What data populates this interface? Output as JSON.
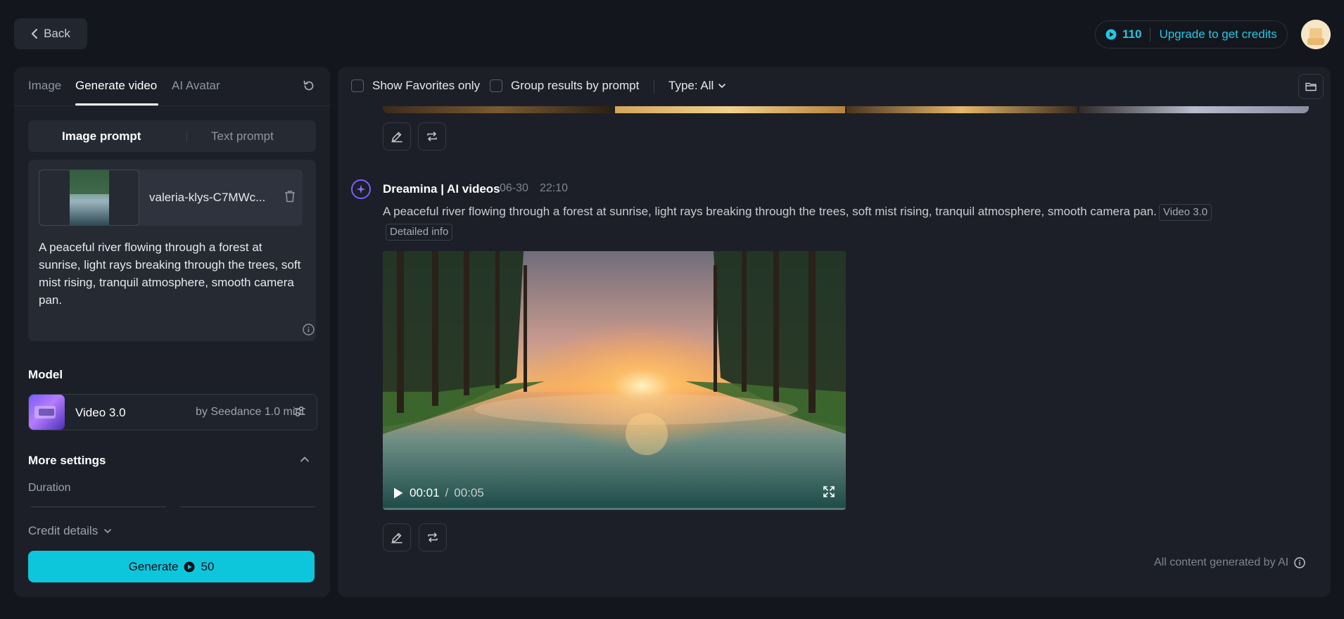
{
  "header": {
    "back_label": "Back",
    "credits": "110",
    "upgrade_label": "Upgrade to get credits"
  },
  "left_panel": {
    "tabs": [
      {
        "label": "Image"
      },
      {
        "label": "Generate video"
      },
      {
        "label": "AI Avatar"
      }
    ],
    "active_tab": "Generate video",
    "prompt_modes": [
      {
        "label": "Image prompt"
      },
      {
        "label": "Text prompt"
      }
    ],
    "active_mode": "Image prompt",
    "file_name": "valeria-klys-C7MWc...",
    "prompt_text": "A peaceful river flowing through a forest at sunrise, light rays breaking through the trees, soft mist rising, tranquil atmosphere, smooth camera pan.",
    "model_label": "Model",
    "model_name": "Video 3.0",
    "model_by": "by Seedance 1.0 mini",
    "more_settings_label": "More settings",
    "duration_label": "Duration",
    "credit_details_label": "Credit details",
    "generate_label": "Generate",
    "generate_cost": "50"
  },
  "right_panel": {
    "filters": {
      "favorites_label": "Show Favorites only",
      "group_label": "Group results by prompt",
      "type_label": "Type: All"
    },
    "post": {
      "author": "Dreamina | AI videos",
      "date": "06-30",
      "time": "22:10",
      "prompt": "A peaceful river flowing through a forest at sunrise, light rays breaking through the trees, soft mist rising, tranquil atmosphere, smooth camera pan.",
      "model_badge": "Video 3.0",
      "details_badge": "Detailed info",
      "video_current": "00:01",
      "video_separator": "/",
      "video_total": "00:05"
    },
    "footer_note": "All content generated by AI"
  },
  "colors": {
    "accent": "#0ec6dc",
    "brand_purple": "#7c5cff",
    "background": "#13161d",
    "panel": "#1c1f27"
  },
  "icons": [
    "chevron-left-icon",
    "credit-coin-icon",
    "refresh-icon",
    "trash-icon",
    "info-icon",
    "sliders-icon",
    "chevron-up-icon",
    "chevron-down-icon",
    "folder-icon",
    "edit-icon",
    "remix-icon",
    "play-icon",
    "fullscreen-icon",
    "dreamina-logo-icon"
  ]
}
